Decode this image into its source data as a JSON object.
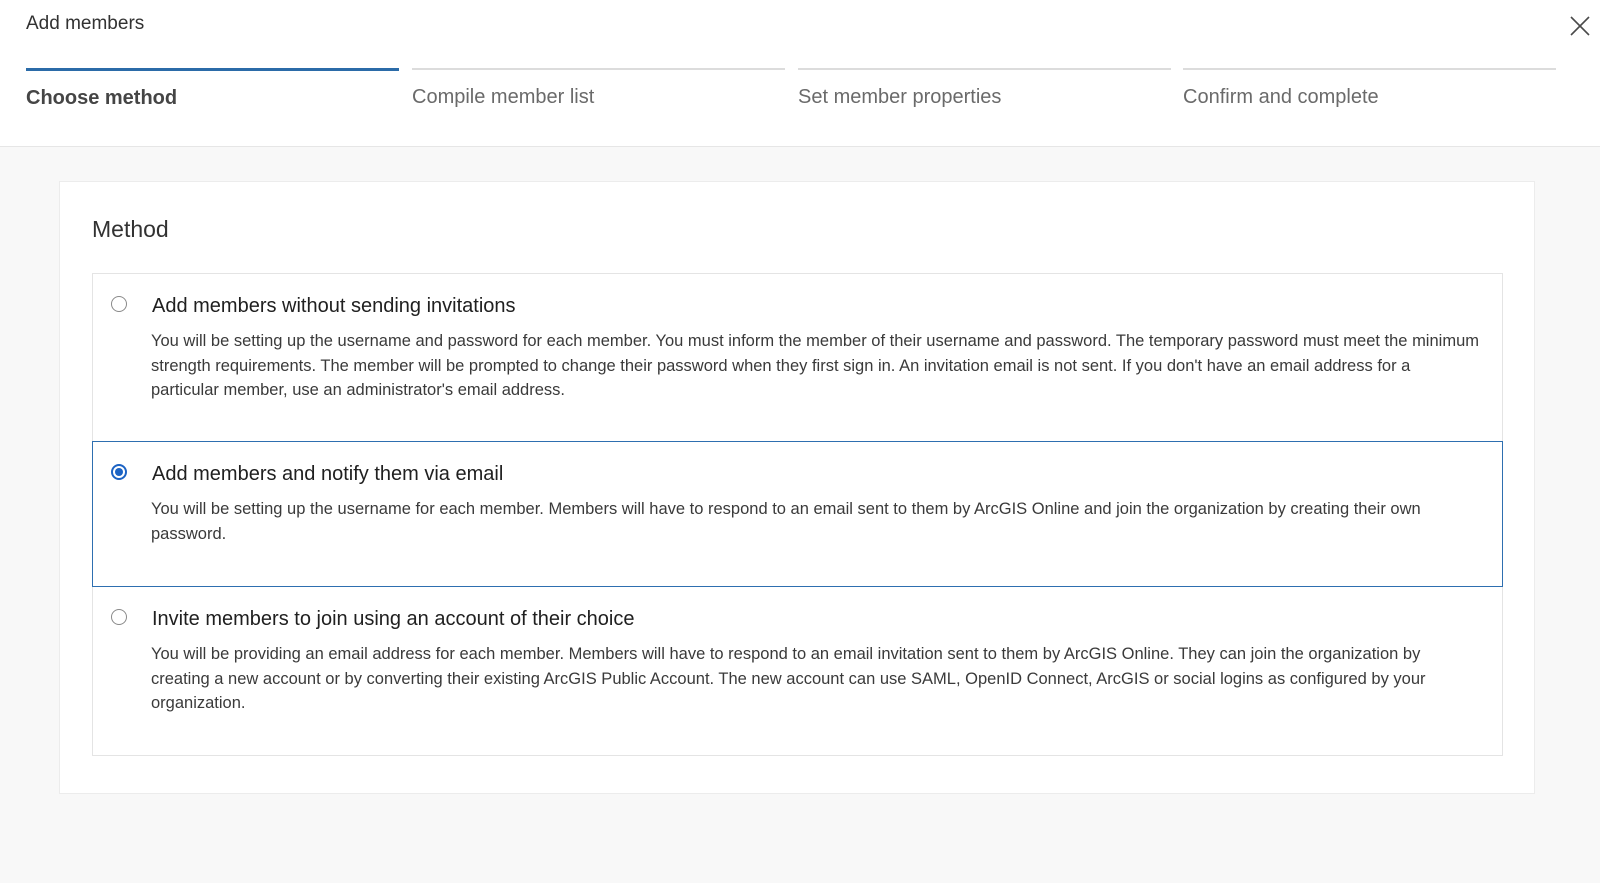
{
  "dialog": {
    "title": "Add members",
    "close_icon": "close-icon"
  },
  "steps": [
    {
      "label": "Choose method",
      "active": true
    },
    {
      "label": "Compile member list",
      "active": false
    },
    {
      "label": "Set member properties",
      "active": false
    },
    {
      "label": "Confirm and complete",
      "active": false
    }
  ],
  "method": {
    "heading": "Method",
    "options": [
      {
        "title": "Add members without sending invitations",
        "description": "You will be setting up the username and password for each member. You must inform the member of their username and password. The temporary password must meet the minimum strength requirements. The member will be prompted to change their password when they first sign in. An invitation email is not sent. If you don't have an email address for a particular member, use an administrator's email address.",
        "selected": false
      },
      {
        "title": "Add members and notify them via email",
        "description": "You will be setting up the username for each member. Members will have to respond to an email sent to them by ArcGIS Online and join the organization by creating their own password.",
        "selected": true
      },
      {
        "title": "Invite members to join using an account of their choice",
        "description": "You will be providing an email address for each member. Members will have to respond to an email invitation sent to them by ArcGIS Online. They can join the organization by creating a new account or by converting their existing ArcGIS Public Account. The new account can use SAML, OpenID Connect, ArcGIS or social logins as configured by your organization.",
        "selected": false
      }
    ]
  },
  "colors": {
    "accent": "#1c63c4",
    "active_step_bar": "#2b6ba8",
    "selected_border": "#2e6fb0",
    "background": "#f8f8f8"
  }
}
